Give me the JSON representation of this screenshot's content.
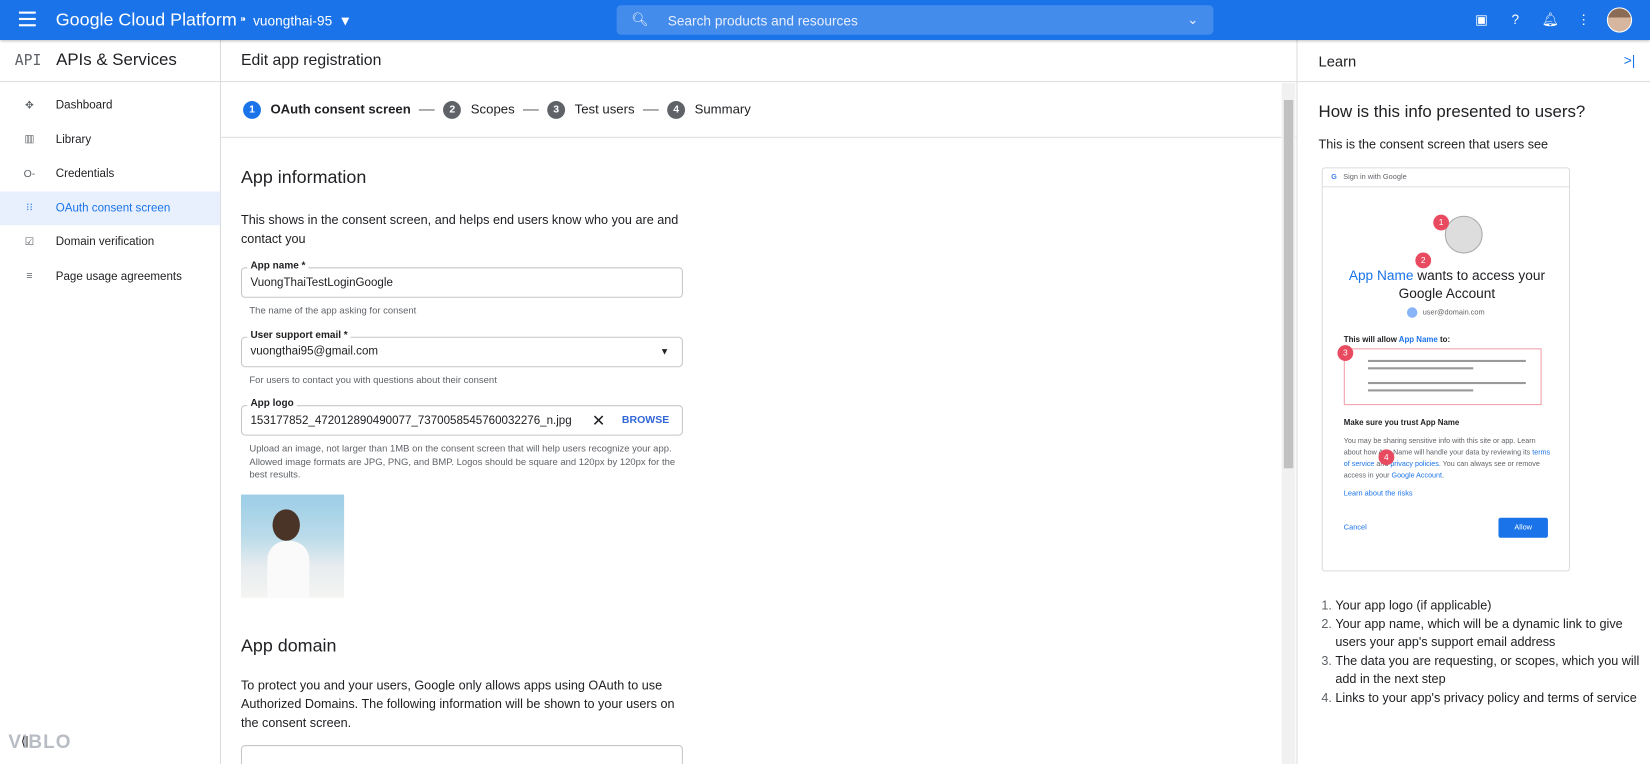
{
  "topbar": {
    "brand": "Google Cloud Platform",
    "project": "vuongthai-95",
    "search_placeholder": "Search products and resources"
  },
  "sidebar": {
    "title": "APIs & Services",
    "logo": "API",
    "items": [
      {
        "label": "Dashboard",
        "icon": "dashboard-icon"
      },
      {
        "label": "Library",
        "icon": "library-icon"
      },
      {
        "label": "Credentials",
        "icon": "key-icon"
      },
      {
        "label": "OAuth consent screen",
        "icon": "consent-icon",
        "active": true
      },
      {
        "label": "Domain verification",
        "icon": "checkbox-icon"
      },
      {
        "label": "Page usage agreements",
        "icon": "settings-list-icon"
      }
    ]
  },
  "main": {
    "title": "Edit app registration",
    "steps": [
      {
        "n": "1",
        "label": "OAuth consent screen"
      },
      {
        "n": "2",
        "label": "Scopes"
      },
      {
        "n": "3",
        "label": "Test users"
      },
      {
        "n": "4",
        "label": "Summary"
      }
    ],
    "app_info": {
      "heading": "App information",
      "description": "This shows in the consent screen, and helps end users know who you are and contact you",
      "app_name": {
        "label": "App name *",
        "value": "VuongThaiTestLoginGoogle",
        "hint": "The name of the app asking for consent"
      },
      "support_email": {
        "label": "User support email *",
        "value": "vuongthai95@gmail.com",
        "hint": "For users to contact you with questions about their consent"
      },
      "app_logo": {
        "label": "App logo",
        "value": "153177852_472012890490077_7370058545760032276_n.jpg",
        "browse": "BROWSE",
        "hint": "Upload an image, not larger than 1MB on the consent screen that will help users recognize your app. Allowed image formats are JPG, PNG, and BMP. Logos should be square and 120px by 120px for the best results."
      }
    },
    "app_domain": {
      "heading": "App domain",
      "description": "To protect you and your users, Google only allows apps using OAuth to use Authorized Domains. The following information will be shown to your users on the consent screen."
    }
  },
  "learn": {
    "title": "Learn",
    "heading": "How is this info presented to users?",
    "subtitle": "This is the consent screen that users see",
    "card": {
      "header": "Sign in with Google",
      "app_name": "App Name",
      "wants": "wants to access your Google Account",
      "email": "user@domain.com",
      "allow_prefix": "This will allow",
      "allow_suffix": "to:",
      "trust": "Make sure you trust App Name",
      "body1": "You may be sharing sensitive info with this site or app. Learn about how App Name will handle your data by reviewing its",
      "tos": "terms of service",
      "and": "and",
      "privacy": "privacy policies",
      "body2": ". You can always see or remove access in your",
      "account": "Google Account",
      "risks": "Learn about the risks",
      "cancel": "Cancel",
      "allow": "Allow",
      "badges": [
        "1",
        "2",
        "3",
        "4"
      ]
    },
    "list": [
      "Your app logo (if applicable)",
      "Your app name, which will be a dynamic link to give users your app's support email address",
      "The data you are requesting, or scopes, which you will add in the next step",
      "Links to your app's privacy policy and terms of service"
    ]
  },
  "watermark": "VIBLO"
}
